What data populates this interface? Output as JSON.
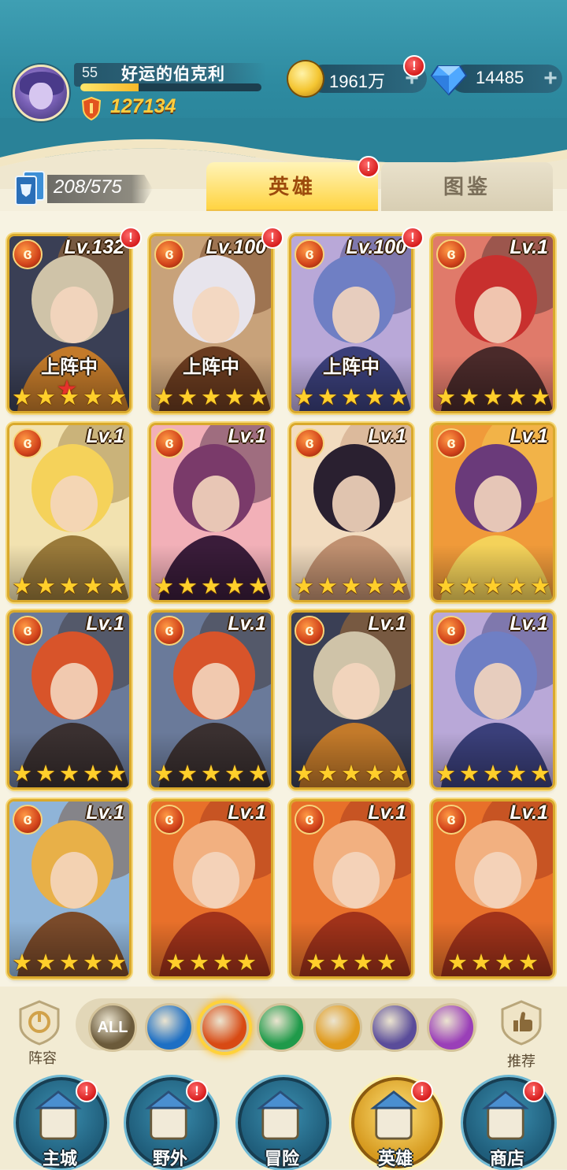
{
  "player": {
    "level": "55",
    "name": "好运的伯克利",
    "exp_fraction": 0.32,
    "power": "127134"
  },
  "resources": {
    "gold": "1961万",
    "diamonds": "14485",
    "plus_glyph": "+"
  },
  "alert_glyph": "!",
  "heroes_count": "208/575",
  "tabs": [
    {
      "label": "英雄",
      "active": true,
      "alert": true
    },
    {
      "label": "图鉴",
      "active": false,
      "alert": false
    }
  ],
  "heroes": [
    {
      "level": "Lv.132",
      "deployed": "上阵中",
      "stars": 5,
      "red_star": true,
      "alert": true,
      "portrait": "white-haired-assassin"
    },
    {
      "level": "Lv.100",
      "deployed": "上阵中",
      "stars": 5,
      "red_star": false,
      "alert": true,
      "portrait": "silver-haired-swordsman"
    },
    {
      "level": "Lv.100",
      "deployed": "上阵中",
      "stars": 5,
      "red_star": false,
      "alert": true,
      "portrait": "blue-orc-warrior"
    },
    {
      "level": "Lv.1",
      "deployed": "",
      "stars": 5,
      "red_star": false,
      "alert": false,
      "portrait": "red-haired-gunner"
    },
    {
      "level": "Lv.1",
      "deployed": "",
      "stars": 5,
      "red_star": false,
      "alert": false,
      "portrait": "blonde-priestess"
    },
    {
      "level": "Lv.1",
      "deployed": "",
      "stars": 5,
      "red_star": false,
      "alert": false,
      "portrait": "pink-haired-witch"
    },
    {
      "level": "Lv.1",
      "deployed": "",
      "stars": 5,
      "red_star": false,
      "alert": false,
      "portrait": "dark-haired-elf"
    },
    {
      "level": "Lv.1",
      "deployed": "",
      "stars": 5,
      "red_star": false,
      "alert": false,
      "portrait": "golden-horned-demon"
    },
    {
      "level": "Lv.1",
      "deployed": "",
      "stars": 5,
      "red_star": false,
      "alert": false,
      "portrait": "red-bearded-dwarf"
    },
    {
      "level": "Lv.1",
      "deployed": "",
      "stars": 5,
      "red_star": false,
      "alert": false,
      "portrait": "red-bearded-dwarf"
    },
    {
      "level": "Lv.1",
      "deployed": "",
      "stars": 5,
      "red_star": false,
      "alert": false,
      "portrait": "white-haired-assassin"
    },
    {
      "level": "Lv.1",
      "deployed": "",
      "stars": 5,
      "red_star": false,
      "alert": false,
      "portrait": "blue-orc-warrior"
    },
    {
      "level": "Lv.1",
      "deployed": "",
      "stars": 5,
      "red_star": false,
      "alert": false,
      "portrait": "golden-dwarf-engineer"
    },
    {
      "level": "Lv.1",
      "deployed": "",
      "stars": 4,
      "red_star": false,
      "alert": false,
      "portrait": "orange-haired-elf"
    },
    {
      "level": "Lv.1",
      "deployed": "",
      "stars": 4,
      "red_star": false,
      "alert": false,
      "portrait": "orange-haired-elf"
    },
    {
      "level": "Lv.1",
      "deployed": "",
      "stars": 4,
      "red_star": false,
      "alert": false,
      "portrait": "orange-haired-elf"
    }
  ],
  "element_glyph": "ɞ",
  "star_glyph": "★",
  "filters": [
    {
      "id": "all",
      "label": "ALL",
      "color": "#6b5a3a",
      "active": false
    },
    {
      "id": "water",
      "label": "",
      "color": "#1d6fc4",
      "active": false
    },
    {
      "id": "fire",
      "label": "",
      "color": "#d84a14",
      "active": true
    },
    {
      "id": "nature",
      "label": "",
      "color": "#1f9a4a",
      "active": false
    },
    {
      "id": "light",
      "label": "",
      "color": "#e09a1c",
      "active": false
    },
    {
      "id": "dark",
      "label": "",
      "color": "#5a4c9a",
      "active": false
    },
    {
      "id": "chaos",
      "label": "",
      "color": "#9a3fb8",
      "active": false
    }
  ],
  "lineup_label": "阵容",
  "recommend_label": "推荐",
  "nav": [
    {
      "label": "主城",
      "alert": true,
      "active": false
    },
    {
      "label": "野外",
      "alert": true,
      "active": false
    },
    {
      "label": "冒险",
      "alert": false,
      "active": false
    },
    {
      "label": "英雄",
      "alert": true,
      "active": true
    },
    {
      "label": "商店",
      "alert": true,
      "active": false
    }
  ]
}
